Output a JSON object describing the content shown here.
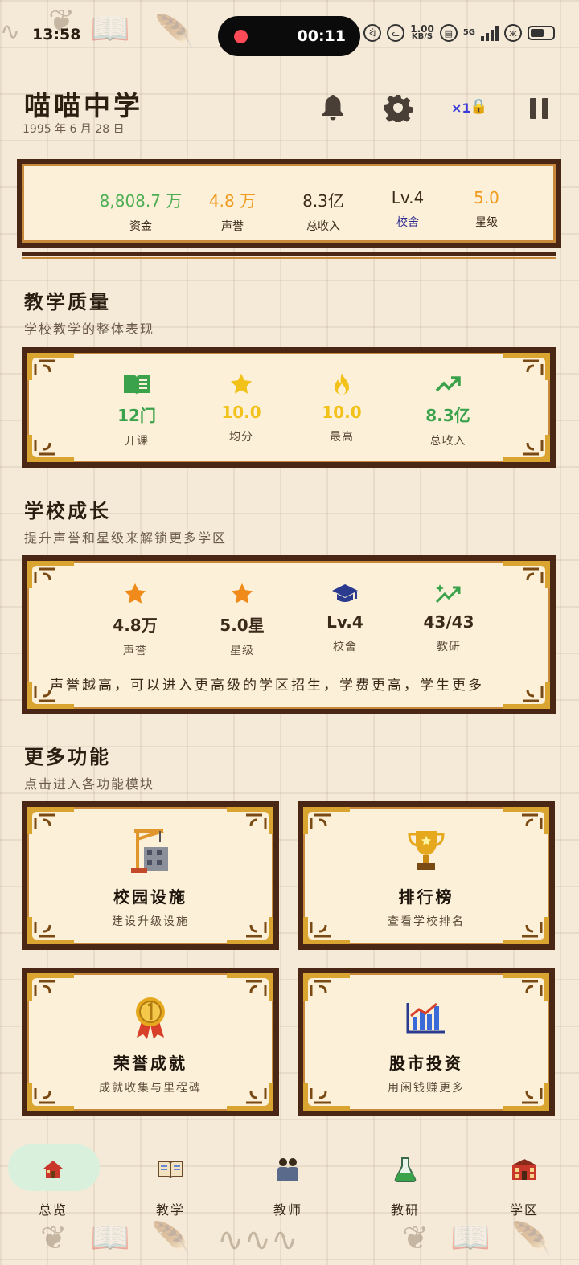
{
  "status_bar": {
    "time": "13:58",
    "recording_timer": "00:11",
    "net_speed_value": "1.00",
    "net_speed_unit": "KB/S",
    "network_type": "5G"
  },
  "header": {
    "school_name": "喵喵中学",
    "date": "1995 年 6 月 28 日",
    "speed": "×1",
    "icons": [
      "bell-icon",
      "gear-icon",
      "lock-icon",
      "pause-icon"
    ]
  },
  "resources": [
    {
      "value": "8,808.7 万",
      "label": "资金",
      "color": "#4bae52"
    },
    {
      "value": "4.8 万",
      "label": "声誉",
      "color": "#f09a1e"
    },
    {
      "value": "8.3亿",
      "label": "总收入",
      "color": "#2a1e12"
    },
    {
      "value": "Lv.4",
      "label": "校舍",
      "color": "#2a1e12"
    },
    {
      "value": "5.0",
      "label": "星级",
      "color": "#f09a1e"
    }
  ],
  "teaching_quality": {
    "title": "教学质量",
    "subtitle": "学校教学的整体表现",
    "stats": [
      {
        "icon": "book-icon",
        "value": "12门",
        "label": "开课",
        "color": "#3aa24a"
      },
      {
        "icon": "star-icon",
        "value": "10.0",
        "label": "均分",
        "color": "#f2c21a"
      },
      {
        "icon": "flame-icon",
        "value": "10.0",
        "label": "最高",
        "color": "#f2c21a"
      },
      {
        "icon": "trend-up-icon",
        "value": "8.3亿",
        "label": "总收入",
        "color": "#3aa24a"
      }
    ]
  },
  "school_growth": {
    "title": "学校成长",
    "subtitle": "提升声誉和星级来解锁更多学区",
    "stats": [
      {
        "icon": "star-icon",
        "value": "4.8万",
        "label": "声誉",
        "color": "#f08a1a"
      },
      {
        "icon": "star-icon",
        "value": "5.0星",
        "label": "星级",
        "color": "#f08a1a"
      },
      {
        "icon": "graduation-cap-icon",
        "value": "Lv.4",
        "label": "校舍",
        "color": "#2a3b8f"
      },
      {
        "icon": "sparkle-trend-icon",
        "value": "43/43",
        "label": "教研",
        "color": "#3aa24a"
      }
    ],
    "note": "声誉越高，可以进入更高级的学区招生，学费更高，学生更多"
  },
  "more_features": {
    "title": "更多功能",
    "subtitle": "点击进入各功能模块",
    "cards": [
      {
        "icon": "construction-icon",
        "title": "校园设施",
        "desc": "建设升级设施"
      },
      {
        "icon": "trophy-icon",
        "title": "排行榜",
        "desc": "查看学校排名"
      },
      {
        "icon": "medal-icon",
        "title": "荣誉成就",
        "desc": "成就收集与里程碑"
      },
      {
        "icon": "stock-chart-icon",
        "title": "股市投资",
        "desc": "用闲钱赚更多"
      }
    ]
  },
  "bottom_nav": [
    {
      "icon": "house-icon",
      "label": "总览",
      "active": true
    },
    {
      "icon": "open-book-icon",
      "label": "教学",
      "active": false
    },
    {
      "icon": "teachers-icon",
      "label": "教师",
      "active": false
    },
    {
      "icon": "flask-icon",
      "label": "教研",
      "active": false
    },
    {
      "icon": "school-building-icon",
      "label": "学区",
      "active": false
    }
  ]
}
